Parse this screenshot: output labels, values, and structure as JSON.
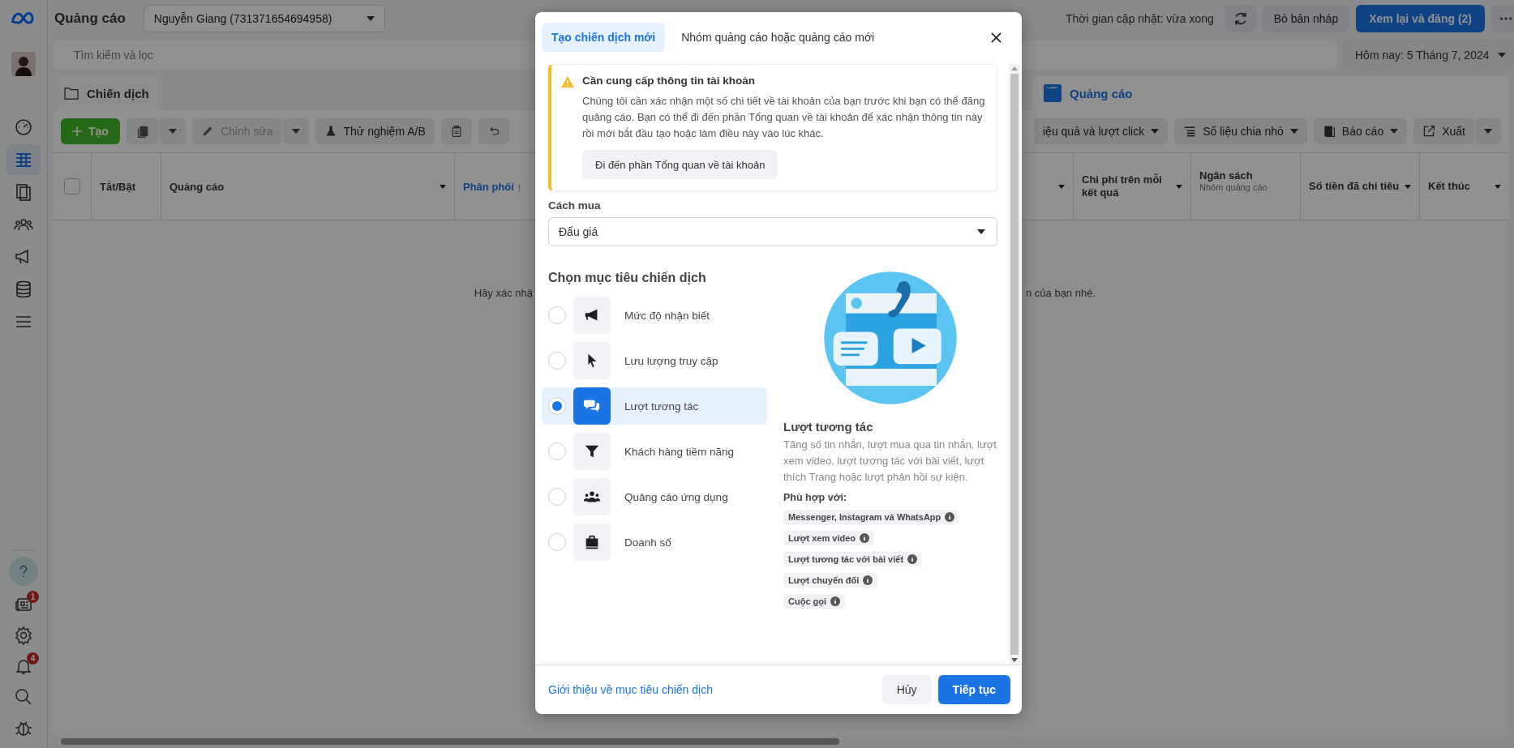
{
  "sidebar": {
    "nav": [
      {
        "selected": false
      },
      {
        "selected": true
      },
      {
        "selected": false
      },
      {
        "selected": false
      },
      {
        "selected": false
      },
      {
        "selected": false
      },
      {
        "selected": false
      }
    ],
    "news_badge": "1",
    "notifications_badge": "4"
  },
  "top_bar": {
    "title": "Quảng cáo",
    "account": "Nguyễn Giang (731371654694958)",
    "update_status": "Thời gian cập nhật: vừa xong",
    "discard": "Bỏ bản nháp",
    "publish": "Xem lại và đăng (2)"
  },
  "search": {
    "placeholder": "Tìm kiếm và lọc",
    "date": "Hôm nay: 5 Tháng 7, 2024"
  },
  "level_tabs": [
    {
      "label": "Chiến dịch",
      "selected": false
    },
    {
      "label": "Quảng cáo",
      "selected": true
    }
  ],
  "toolbar": {
    "create": "Tạo",
    "edit": "Chỉnh sửa",
    "edit_disabled": true,
    "ab_test": "Thử nghiệm A/B",
    "columns": "iệu quả và lượt click",
    "breakdown": "Số liệu chia nhỏ",
    "reports": "Báo cáo",
    "export": "Xuất"
  },
  "table": {
    "select_all": {
      "checked": false
    },
    "left_columns": [
      {
        "label": "Tắt/Bật",
        "sorted": false
      },
      {
        "label": "Quảng cáo",
        "sorted": false
      },
      {
        "label": "Phân phối ↑",
        "sorted": true
      }
    ],
    "right_columns": [
      {
        "label": "Chi phí trên mỗi kết quả",
        "sorted": false
      },
      {
        "label": "Ngân sách",
        "sub": "Nhóm quảng cáo",
        "sorted": false
      },
      {
        "label": "Số tiền đã chi tiêu",
        "sorted": false
      },
      {
        "label": "Kết thúc",
        "sorted": false
      }
    ],
    "empty_message": [
      "Hãy xác nhậ",
      "n của bạn nhé."
    ]
  },
  "modal": {
    "tabs": [
      {
        "label": "Tạo chiến dịch mới",
        "selected": true
      },
      {
        "label": "Nhóm quảng cáo hoặc quảng cáo mới",
        "selected": false
      }
    ],
    "alert": {
      "title": "Cần cung cấp thông tin tài khoản",
      "body": "Chúng tôi cần xác nhận một số chi tiết về tài khoản của bạn trước khi bạn có thể đăng quảng cáo. Bạn có thể đi đến phần Tổng quan về tài khoản để xác nhận thông tin này rồi mới bắt đầu tạo hoặc làm điều này vào lúc khác.",
      "button": "Đi đến phần Tổng quan về tài khoản"
    },
    "buying_type": {
      "label": "Cách mua",
      "value": "Đấu giá"
    },
    "objectives_title": "Chọn mục tiêu chiến dịch",
    "objectives": [
      {
        "label": "Mức độ nhận biết",
        "selected": false
      },
      {
        "label": "Lưu lượng truy cập",
        "selected": false
      },
      {
        "label": "Lượt tương tác",
        "selected": true
      },
      {
        "label": "Khách hàng tiềm năng",
        "selected": false
      },
      {
        "label": "Quảng cáo ứng dụng",
        "selected": false
      },
      {
        "label": "Doanh số",
        "selected": false
      }
    ],
    "detail": {
      "title": "Lượt tương tác",
      "description": "Tăng số tin nhắn, lượt mua qua tin nhắn, lượt xem video, lượt tương tác với bài viết, lượt thích Trang hoặc lượt phản hồi sự kiện.",
      "fit_label": "Phù hợp với:",
      "fits": [
        "Messenger, Instagram và WhatsApp",
        "Lượt xem video",
        "Lượt tương tác với bài viết",
        "Lượt chuyển đổi",
        "Cuộc gọi"
      ]
    },
    "footer": {
      "link": "Giới thiệu về mục tiêu chiến dịch",
      "cancel": "Hủy",
      "continue": "Tiếp tục"
    }
  }
}
